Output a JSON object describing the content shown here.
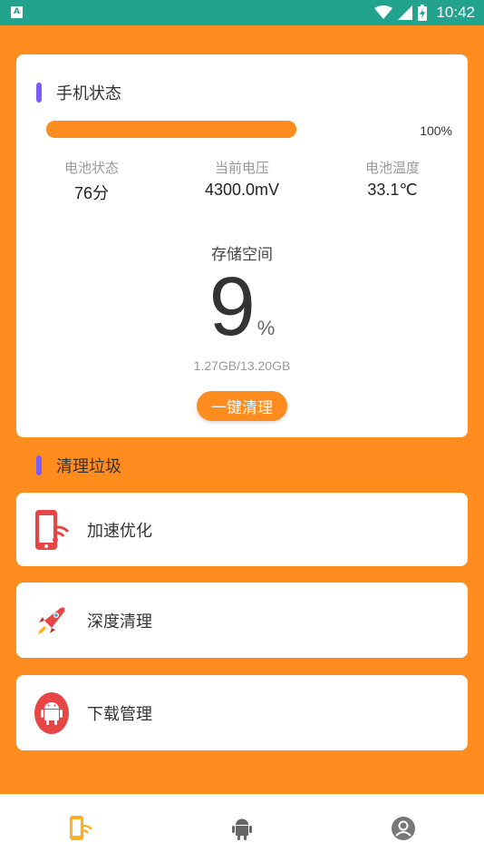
{
  "statusbar": {
    "app_badge": "A",
    "time": "10:42",
    "icons": [
      "wifi-icon",
      "signal-icon",
      "battery-charging-icon"
    ]
  },
  "phone_status": {
    "title": "手机状态",
    "progress_label": "100%",
    "progress_fraction": 1.0,
    "stats": [
      {
        "label": "电池状态",
        "value": "76分"
      },
      {
        "label": "当前电压",
        "value": "4300.0mV"
      },
      {
        "label": "电池温度",
        "value": "33.1℃"
      }
    ],
    "storage": {
      "title": "存储空间",
      "percent": "9",
      "percent_unit": "%",
      "detail": "1.27GB/13.20GB"
    },
    "clean_button": "一键清理"
  },
  "junk": {
    "title": "清理垃圾",
    "items": [
      {
        "label": "加速优化",
        "icon": "phone-wifi-icon"
      },
      {
        "label": "深度清理",
        "icon": "rocket-icon"
      },
      {
        "label": "下载管理",
        "icon": "android-icon"
      }
    ]
  },
  "bottom_nav": {
    "items": [
      "phone-wifi-icon",
      "android-icon",
      "user-icon"
    ]
  },
  "colors": {
    "background": "#FF8C1F",
    "status_bar": "#21A38E",
    "accent_bar": "#7B5CFF",
    "icon_red": "#E84545"
  }
}
